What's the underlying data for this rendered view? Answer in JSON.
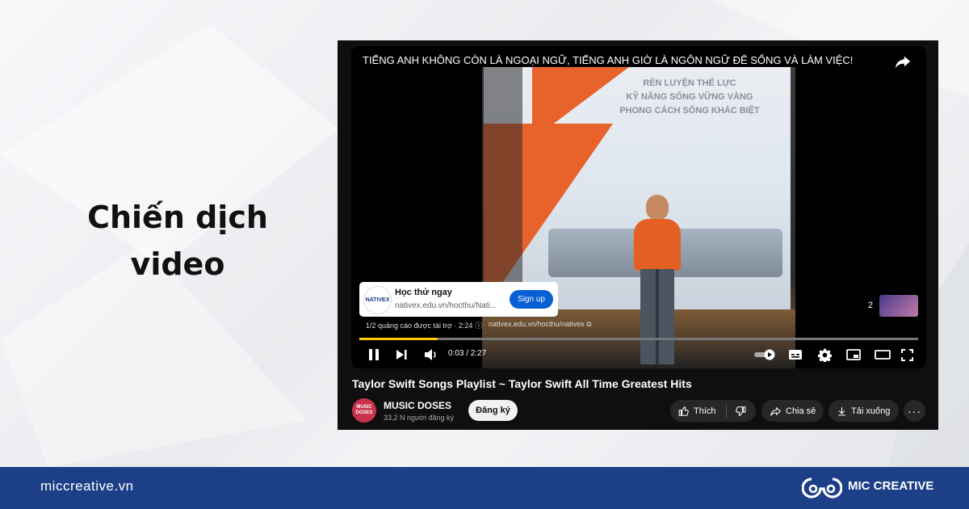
{
  "headline": {
    "line1": "Chiến dịch",
    "line2": "video"
  },
  "video": {
    "overlay_title": "TIẾNG ANH KHÔNG CÒN LÀ NGOẠI NGỮ, TIẾNG ANH GIỜ LÀ NGÔN NGỮ ĐỂ SỐNG VÀ LÀM VIỆC!",
    "slide_text": [
      "RÈN LUYỆN THỂ LỰC",
      "KỸ NĂNG SỐNG VỮNG VÀNG",
      "PHONG CÁCH SỐNG KHÁC BIỆT"
    ],
    "ad": {
      "logo_text": "NATIVEX",
      "name": "Học thử ngay",
      "url": "nativex.edu.vn/hocthu/Nati...",
      "cta": "Sign up",
      "meta": "1/2 quảng cáo được tài trợ · 2:24",
      "link": "nativex.edu.vn/hocthu/nativex"
    },
    "time": "0:03 / 2:27",
    "progress": 0.14,
    "next_count": "2"
  },
  "info": {
    "title": "Taylor Swift Songs Playlist ~ Taylor Swift All Time Greatest Hits",
    "channel": "MUSIC DOSES",
    "avatar_text": "MUSIC DOSES",
    "subscribers": "33,2 N người đăng ký",
    "subscribe_label": "Đăng ký",
    "like_label": "Thích",
    "share_label": "Chia sẻ",
    "download_label": "Tải xuống"
  },
  "footer": {
    "url": "miccreative.vn",
    "brand": "MIC CREATIVE"
  },
  "colors": {
    "footer_bg": "#1c3f88",
    "accent_orange": "#e8622c",
    "signup_blue": "#065fd4",
    "progress": "#ffcc00"
  }
}
